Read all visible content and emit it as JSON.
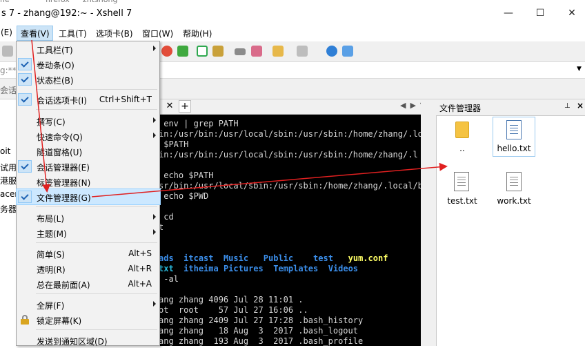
{
  "window": {
    "title": "s 7 - zhang@192:~ - Xshell 7",
    "taskbar_fragments": [
      "he",
      "firefox",
      "zhtshong"
    ],
    "minimize": "—",
    "maximize": "☐",
    "close": "✕"
  },
  "menubar": {
    "items": [
      {
        "label": "(E)"
      },
      {
        "label": "查看(V)"
      },
      {
        "label": "工具(T)"
      },
      {
        "label": "选项卡(B)"
      },
      {
        "label": "窗口(W)"
      },
      {
        "label": "帮助(H)"
      }
    ]
  },
  "address": {
    "value": "g:***"
  },
  "session_tab_fragment": "会话",
  "left_panel": [
    "oit",
    "试用",
    "港服",
    "acent",
    "务器"
  ],
  "view_menu": {
    "items": [
      {
        "label": "工具栏(T)",
        "submenu": true
      },
      {
        "label": "卷动条(O)",
        "checked": true
      },
      {
        "label": "状态栏(B)",
        "checked": true
      },
      {
        "label": "会话选项卡(I)",
        "checked": true,
        "shortcut": "Ctrl+Shift+T"
      },
      {
        "label": "撰写(C)",
        "submenu": true
      },
      {
        "label": "快速命令(Q)",
        "submenu": true
      },
      {
        "label": "隧道窗格(U)"
      },
      {
        "label": "会话管理器(E)",
        "checked": true
      },
      {
        "label": "标签管理器(N)"
      },
      {
        "label": "文件管理器(G)",
        "checked": true
      },
      {
        "label": "布局(L)",
        "submenu": true
      },
      {
        "label": "主题(M)",
        "submenu": true
      },
      {
        "label": "简单(S)",
        "shortcut": "Alt+S"
      },
      {
        "label": "透明(R)",
        "shortcut": "Alt+R"
      },
      {
        "label": "总在最前面(A)",
        "shortcut": "Alt+A"
      },
      {
        "label": "全屏(F)",
        "submenu": true
      },
      {
        "label": "锁定屏幕(K)",
        "icon": "lock-icon"
      },
      {
        "label": "发送到通知区域(D)"
      }
    ]
  },
  "terminal": {
    "lines": [
      " env | grep PATH",
      "in:/usr/bin:/usr/local/sbin:/usr/sbin:/home/zhang/.lo",
      " $PATH",
      "in:/usr/bin:/usr/local/sbin:/usr/sbin:/home/zhang/.l",
      "",
      " echo $PATH",
      "sr/bin:/usr/local/sbin:/usr/sbin:/home/zhang/.local/b",
      " echo $PWD",
      "",
      " cd",
      "t",
      "",
      "",
      "ads  itcast  Music   Public   test   yum.conf",
      "txt  itheima  Pictures  Templates  Videos",
      " -al",
      "",
      "ang zhang 4096 Jul 28 11:01 .",
      "ot  root    57 Jul 27 16:06 ..",
      "ang zhang 2409 Jul 27 17:28 .bash_history",
      "ang zhang   18 Aug  3  2017 .bash_logout",
      "ang zhang  193 Aug  3  2017 .bash_profile"
    ]
  },
  "file_manager": {
    "title": "文件管理器",
    "pin": "⊥",
    "close": "×",
    "files": [
      {
        "name": "..",
        "kind": "folder"
      },
      {
        "name": "hello.txt",
        "kind": "file",
        "selected": true
      },
      {
        "name": "test.txt",
        "kind": "file"
      },
      {
        "name": "work.txt",
        "kind": "file"
      }
    ]
  },
  "annotation_color": "#e02020"
}
